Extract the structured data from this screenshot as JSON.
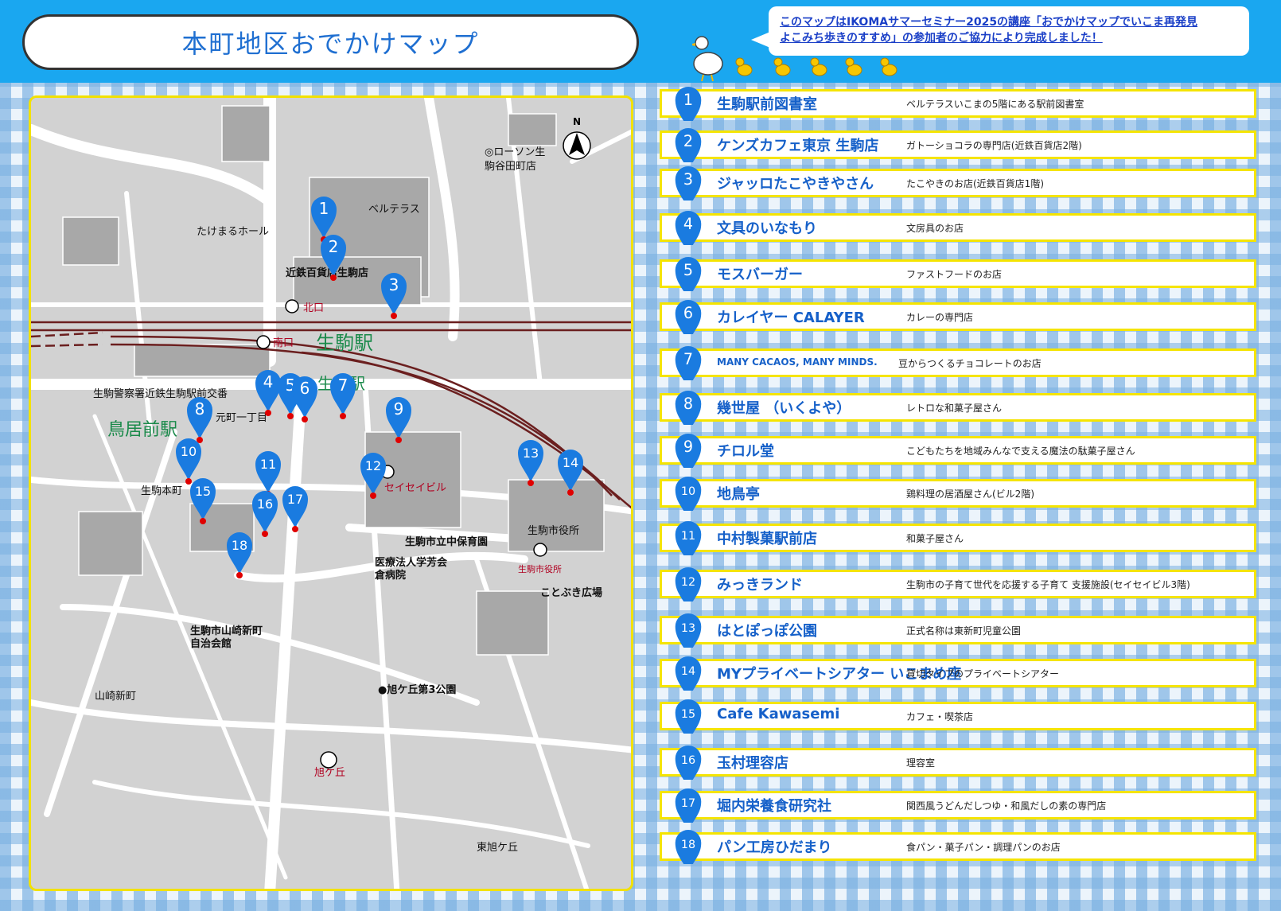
{
  "title": "本町地区おでかけマップ",
  "notice": {
    "line1": "このマップはIKOMAサマーセミナー2025の講座「おでかけマップでいこま再発見",
    "line2": "よこみち歩きのすすめ」の参加者のご協力により完成しました！"
  },
  "map": {
    "compass": "N",
    "labels": {
      "lawson_1": "◎ローソン生",
      "lawson_2": "駒谷田町店",
      "belterrace": "ベルテラス",
      "takemaru": "たけまるホール",
      "kintetsu": "近鉄百貨店生駒店",
      "kitaguchi": "北口",
      "minamiguchi": "南口",
      "station_big": "生駒駅",
      "station_small": "生駒駅",
      "police": "生駒警察署近鉄生駒駅前交番",
      "toriimae": "鳥居前駅",
      "motomachi": "元町一丁目",
      "honmachi": "生駒本町",
      "seiseibiru": "セイセイビル",
      "hoikuen": "生駒市立中保育園",
      "hospital_1": "医療法人学芳会",
      "hospital_2": "倉病院",
      "cityhall_name": "生駒市役所",
      "cityhall_bus": "生駒市役所",
      "kotobuki": "ことぶき広場",
      "jichikai_1": "生駒市山崎新町",
      "jichikai_2": "自治会館",
      "yamazaki": "山崎新町",
      "park3": "●旭ケ丘第3公園",
      "asahigaoka": "旭ケ丘",
      "higashi": "東旭ケ丘"
    }
  },
  "spots": [
    {
      "no": "1",
      "name": "生駒駅前図書室",
      "desc": "ベルテラスいこまの5階にある駅前図書室"
    },
    {
      "no": "2",
      "name": "ケンズカフェ東京 生駒店",
      "desc": "ガトーショコラの専門店(近鉄百貨店2階)"
    },
    {
      "no": "3",
      "name": "ジャッロたこやきやさん",
      "desc": "たこやきのお店(近鉄百貨店1階)"
    },
    {
      "no": "4",
      "name": "文具のいなもり",
      "desc": "文房具のお店"
    },
    {
      "no": "5",
      "name": "モスバーガー",
      "desc": "ファストフードのお店"
    },
    {
      "no": "6",
      "name": "カレイヤー CALAYER",
      "desc": "カレーの専門店"
    },
    {
      "no": "7",
      "name": "MANY CACAOS, MANY MINDS.",
      "desc": "豆からつくるチョコレートのお店"
    },
    {
      "no": "8",
      "name": "幾世屋 （いくよや）",
      "desc": "レトロな和菓子屋さん"
    },
    {
      "no": "9",
      "name": "チロル堂",
      "desc": "こどもたちを地域みんなで支える魔法の駄菓子屋さん"
    },
    {
      "no": "10",
      "name": "地鳥亭",
      "desc": "鶏料理の居酒屋さん(ビル2階)"
    },
    {
      "no": "11",
      "name": "中村製菓駅前店",
      "desc": "和菓子屋さん"
    },
    {
      "no": "12",
      "name": "みっきランド",
      "desc": "生駒市の子育て世代を応援する子育て 支援施設(セイセイビル3階)"
    },
    {
      "no": "13",
      "name": "はとぽっぽ公園",
      "desc": "正式名称は東新町児童公園"
    },
    {
      "no": "14",
      "name": "MYプライベートシアター いこまめ座",
      "desc": "貸切タイプのプライベートシアター"
    },
    {
      "no": "15",
      "name": "Cafe Kawasemi",
      "desc": "カフェ・喫茶店"
    },
    {
      "no": "16",
      "name": "玉村理容店",
      "desc": "理容室"
    },
    {
      "no": "17",
      "name": "堀内栄養食研究社",
      "desc": "関西風うどんだしつゆ・和風だしの素の専門店"
    },
    {
      "no": "18",
      "name": "パン工房ひだまり",
      "desc": "食パン・菓子パン・調理パンのお店"
    }
  ],
  "colors": {
    "header": "#1aa7f0",
    "pin": "#1a7be0",
    "name_text": "#1560c9",
    "frame": "#f5e400",
    "rail": "#6b1f1f",
    "spot_dot": "#e00000"
  }
}
